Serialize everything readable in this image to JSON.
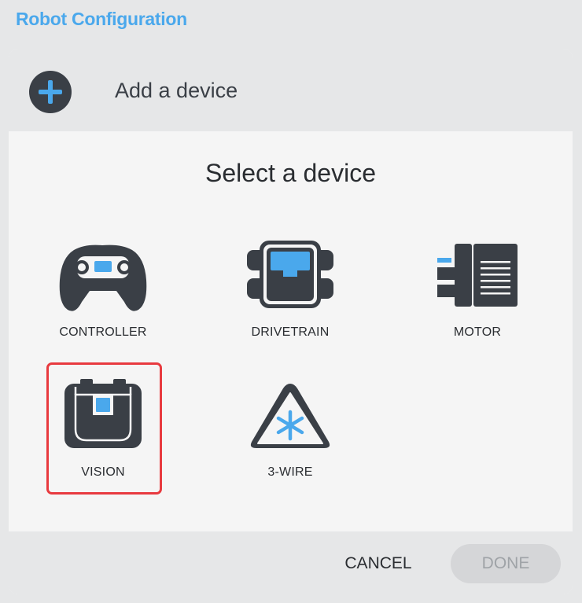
{
  "app": {
    "title": "Robot Configuration"
  },
  "dialog": {
    "header_text": "Add a device",
    "select_title": "Select a device",
    "devices": [
      {
        "label": "CONTROLLER",
        "icon": "controller-icon"
      },
      {
        "label": "DRIVETRAIN",
        "icon": "drivetrain-icon"
      },
      {
        "label": "MOTOR",
        "icon": "motor-icon"
      },
      {
        "label": "VISION",
        "icon": "vision-icon",
        "selected": true
      },
      {
        "label": "3-WIRE",
        "icon": "three-wire-icon"
      }
    ],
    "cancel_label": "CANCEL",
    "done_label": "DONE"
  },
  "colors": {
    "accent": "#4aa8ec",
    "icon_dark": "#3a3f46",
    "selection": "#e83a3f"
  }
}
